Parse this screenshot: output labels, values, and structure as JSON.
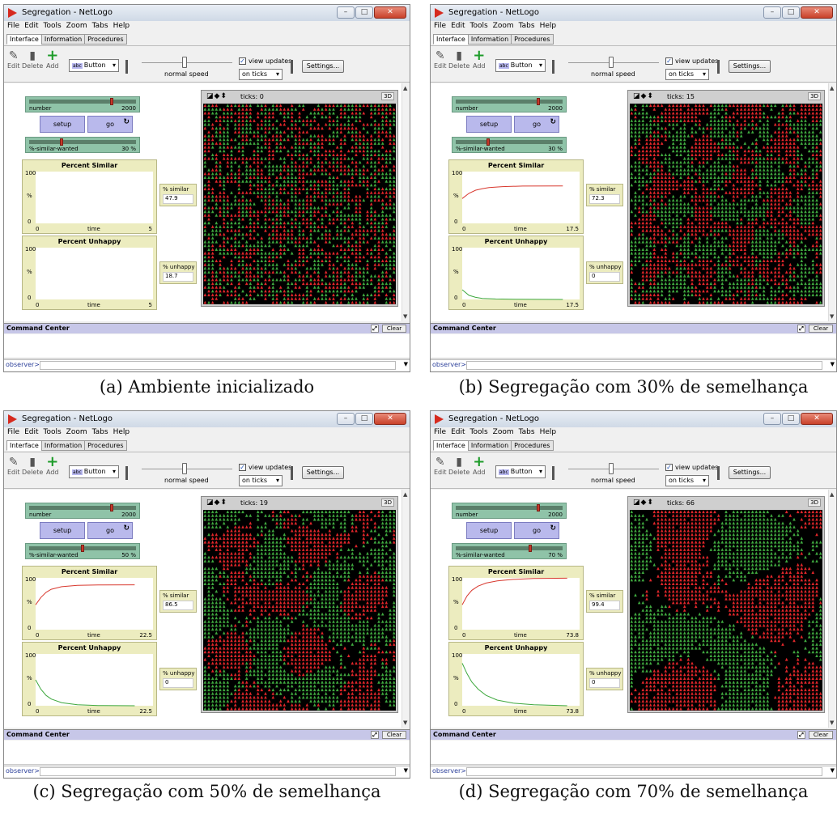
{
  "colors": {
    "red_agent": "#e0262a",
    "green_agent": "#3fa83f",
    "plot_similar_line": "#d8382e",
    "plot_unhappy_line": "#3ea83e",
    "widget_bg": "#ececbf",
    "slider_bg": "#8fc3a8",
    "button_bg": "#b9b9ec"
  },
  "common": {
    "window_title": "Segregation - NetLogo",
    "menu": [
      "File",
      "Edit",
      "Tools",
      "Zoom",
      "Tabs",
      "Help"
    ],
    "tabs": [
      "Interface",
      "Information",
      "Procedures"
    ],
    "toolbar": {
      "edit": "Edit",
      "delete": "Delete",
      "add": "Add",
      "widget_type": "Button",
      "widget_type_badge": "abc",
      "speed_label": "normal speed",
      "view_updates": "view updates",
      "update_mode": "on ticks",
      "settings": "Settings..."
    },
    "number_label": "number",
    "number_value": "2000",
    "setup_label": "setup",
    "go_label": "go",
    "go_forever_icon": "forever-arrows-icon",
    "similar_wanted_label": "%-similar-wanted",
    "plot_similar_title": "Percent Similar",
    "plot_unhappy_title": "Percent Unhappy",
    "plot_ymax": "100",
    "plot_ymin": "0",
    "plot_ylabel": "%",
    "plot_x0": "0",
    "plot_xlabel": "time",
    "monitor_similar_label": "% similar",
    "monitor_unhappy_label": "% unhappy",
    "view_3d": "3D",
    "command_center": "Command Center",
    "clear": "Clear",
    "observer_prompt": "observer>"
  },
  "panels": [
    {
      "caption": "(a) Ambiente inicializado",
      "ticks": "ticks: 0",
      "similar_wanted": "30 %",
      "similar_wanted_value": 30,
      "x_max": "5",
      "pct_similar": "47.9",
      "pct_unhappy": "18.7",
      "similar_curve": [],
      "unhappy_curve": [],
      "cluster_level": 0
    },
    {
      "caption": "(b) Segregação com 30% de semelhança",
      "ticks": "ticks: 15",
      "similar_wanted": "30 %",
      "similar_wanted_value": 30,
      "x_max": "17.5",
      "pct_similar": "72.3",
      "pct_unhappy": "0",
      "similar_curve": [
        [
          0,
          48
        ],
        [
          1,
          58
        ],
        [
          2,
          64
        ],
        [
          3,
          67
        ],
        [
          4,
          69
        ],
        [
          6,
          71
        ],
        [
          9,
          72
        ],
        [
          15,
          72.3
        ]
      ],
      "unhappy_curve": [
        [
          0,
          18.7
        ],
        [
          1,
          8
        ],
        [
          2,
          4
        ],
        [
          3,
          2
        ],
        [
          5,
          1
        ],
        [
          8,
          0.3
        ],
        [
          15,
          0
        ]
      ],
      "cluster_level": 1
    },
    {
      "caption": "(c) Segregação com 50% de semelhança",
      "ticks": "ticks: 19",
      "similar_wanted": "50 %",
      "similar_wanted_value": 50,
      "x_max": "22.5",
      "pct_similar": "86.5",
      "pct_unhappy": "0",
      "similar_curve": [
        [
          0,
          48
        ],
        [
          1,
          62
        ],
        [
          2,
          72
        ],
        [
          3,
          78
        ],
        [
          5,
          83
        ],
        [
          8,
          85.5
        ],
        [
          12,
          86.3
        ],
        [
          19,
          86.5
        ]
      ],
      "unhappy_curve": [
        [
          0,
          50
        ],
        [
          1,
          32
        ],
        [
          2,
          20
        ],
        [
          3,
          13
        ],
        [
          5,
          6
        ],
        [
          8,
          2
        ],
        [
          12,
          0.5
        ],
        [
          19,
          0
        ]
      ],
      "cluster_level": 2
    },
    {
      "caption": "(d) Segregação com 70% de semelhança",
      "ticks": "ticks: 66",
      "similar_wanted": "70 %",
      "similar_wanted_value": 70,
      "x_max": "73.8",
      "pct_similar": "99.4",
      "pct_unhappy": "0",
      "similar_curve": [
        [
          0,
          48
        ],
        [
          3,
          65
        ],
        [
          6,
          76
        ],
        [
          10,
          84
        ],
        [
          15,
          90
        ],
        [
          22,
          94
        ],
        [
          32,
          97
        ],
        [
          45,
          98.8
        ],
        [
          66,
          99.4
        ]
      ],
      "unhappy_curve": [
        [
          0,
          82
        ],
        [
          3,
          62
        ],
        [
          6,
          46
        ],
        [
          10,
          32
        ],
        [
          15,
          20
        ],
        [
          22,
          11
        ],
        [
          32,
          5
        ],
        [
          45,
          2
        ],
        [
          66,
          0
        ]
      ],
      "cluster_level": 3
    }
  ]
}
